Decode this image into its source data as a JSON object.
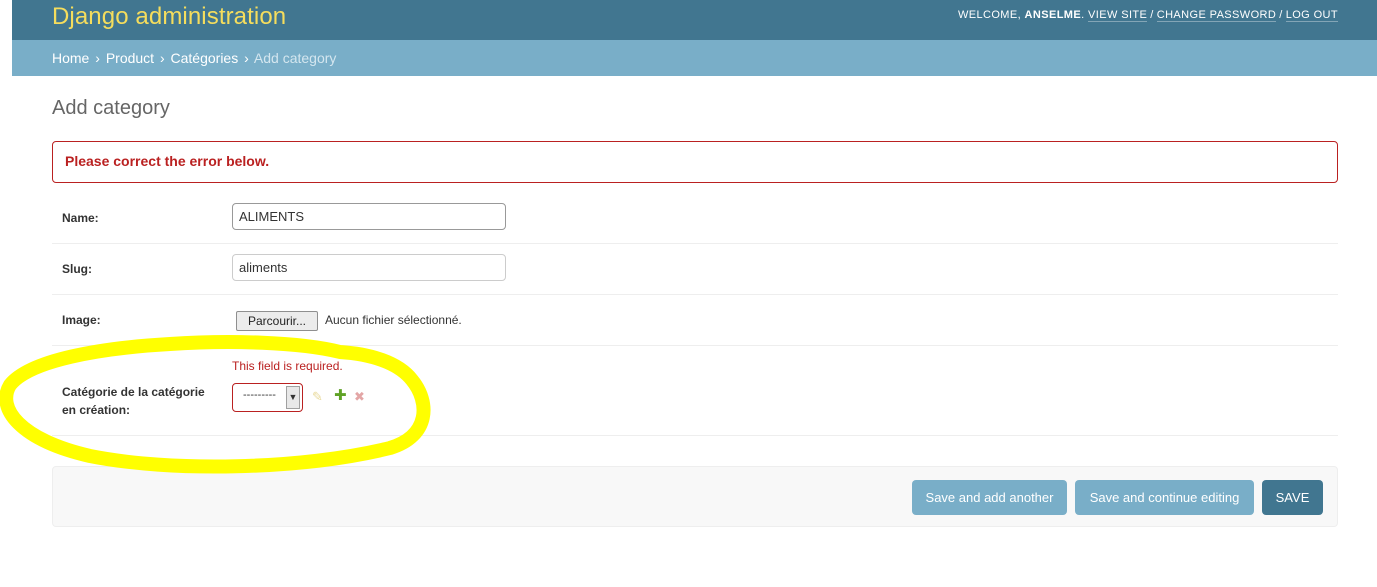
{
  "header": {
    "branding": "Django administration",
    "welcome": "Welcome,",
    "username": "anselme",
    "links": [
      "View site",
      "Change password",
      "Log out"
    ],
    "brand_color": "#417690",
    "title_color": "#f5dd5d"
  },
  "breadcrumbs": {
    "items": [
      "Home",
      "Product",
      "Catégories"
    ],
    "current": "Add category",
    "separator": "›"
  },
  "main": {
    "title": "Add category",
    "errornote": "Please correct the error below.",
    "error_color": "#ba2121"
  },
  "form": {
    "name": {
      "label": "Name:",
      "value": "ALIMENTS"
    },
    "slug": {
      "label": "Slug:",
      "value": "aliments"
    },
    "image": {
      "label": "Image:",
      "button": "Parcourir...",
      "status": "Aucun fichier sélectionné."
    },
    "parent": {
      "label_line1": "Catégorie de la catégorie",
      "label_line2": "en création:",
      "error": "This field is required.",
      "selected": "---------",
      "icons": [
        "pencil-icon",
        "plus-icon",
        "x-icon"
      ]
    }
  },
  "submit": {
    "save_add_another": "Save and add another",
    "save_continue": "Save and continue editing",
    "save": "SAVE"
  },
  "annotation": {
    "color": "#ffff00"
  }
}
